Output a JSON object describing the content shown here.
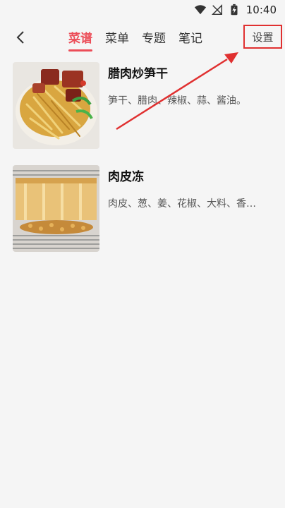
{
  "status_bar": {
    "time": "10:40",
    "icons": [
      "wifi-icon",
      "no-signal-icon",
      "battery-charging-icon"
    ]
  },
  "nav": {
    "back_icon": "chevron-left-icon",
    "tabs": [
      {
        "label": "菜谱",
        "active": true
      },
      {
        "label": "菜单",
        "active": false
      },
      {
        "label": "专题",
        "active": false
      },
      {
        "label": "笔记",
        "active": false
      }
    ],
    "settings_label": "设置"
  },
  "recipes": [
    {
      "title": "腊肉炒笋干",
      "ingredients": "笋干、腊肉、辣椒、蒜、酱油。"
    },
    {
      "title": "肉皮冻",
      "ingredients": "肉皮、葱、姜、花椒、大料、香…"
    }
  ],
  "colors": {
    "accent": "#ec4d58",
    "annotation": "#e03030",
    "background": "#f5f5f5"
  }
}
